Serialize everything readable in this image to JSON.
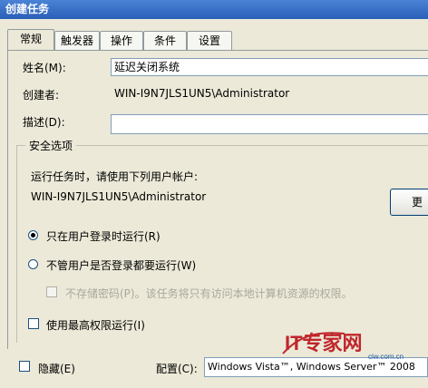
{
  "window": {
    "title": "创建任务"
  },
  "tabs": [
    "常规",
    "触发器",
    "操作",
    "条件",
    "设置"
  ],
  "general": {
    "name_label": "姓名(M):",
    "name_value": "延迟关闭系统",
    "author_label": "创建者:",
    "author_value": "WIN-I9N7JLS1UN5\\Administrator",
    "description_label": "描述(D):",
    "description_value": ""
  },
  "security": {
    "group_title": "安全选项",
    "run_as_prompt": "运行任务时，请使用下列用户帐户:",
    "run_as_user": "WIN-I9N7JLS1UN5\\Administrator",
    "change_user_button": "更",
    "opt_logged_on": "只在用户登录时运行(R)",
    "opt_any": "不管用户是否登录都要运行(W)",
    "opt_no_store_password": "不存储密码(P)。该任务将只有访问本地计算机资源的权限。",
    "opt_highest_privileges": "使用最高权限运行(I)",
    "selected_option": "opt_logged_on"
  },
  "footer": {
    "hidden_label": "隐藏(E)",
    "config_label": "配置(C):",
    "config_value": "Windows Vista™, Windows Server™ 2008"
  },
  "watermark": {
    "text": "IT专家网",
    "subtext": "ciw.com.cn"
  },
  "colors": {
    "titlebar": "#2a5fb8",
    "dialog_bg": "#ece9d8",
    "watermark_it": "#c0262c",
    "watermark_cn": "#1f5fa8"
  }
}
